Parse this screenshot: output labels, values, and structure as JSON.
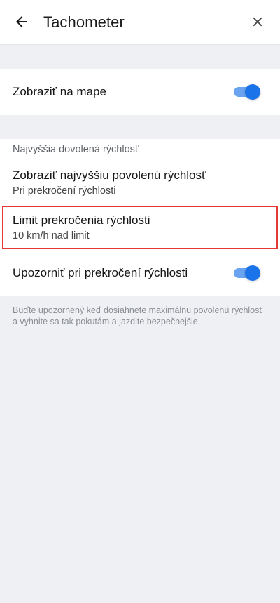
{
  "header": {
    "title": "Tachometer",
    "back_icon": "arrow-left-icon",
    "close_icon": "close-icon"
  },
  "show_on_map": {
    "label": "Zobraziť na mape",
    "enabled": true
  },
  "speed_limit_section": {
    "label": "Najvyššia dovolená rýchlosť"
  },
  "show_max_speed": {
    "title": "Zobraziť najvyššiu povolenú rýchlosť",
    "subtitle": "Pri prekročení rýchlosti"
  },
  "overspeed_limit": {
    "title": "Limit prekročenia rýchlosti",
    "subtitle": "10 km/h nad limit"
  },
  "warn_overspeed": {
    "label": "Upozorniť pri prekročení rýchlosti",
    "enabled": true
  },
  "footer_note": "Buďte upozornený keď dosiahnete maximálnu povolenú rýchlosť a vyhnite sa tak pokutám a jazdite bezpečnejšie.",
  "colors": {
    "accent": "#1a73e8",
    "highlight": "#e53935",
    "background": "#eef0f4"
  }
}
